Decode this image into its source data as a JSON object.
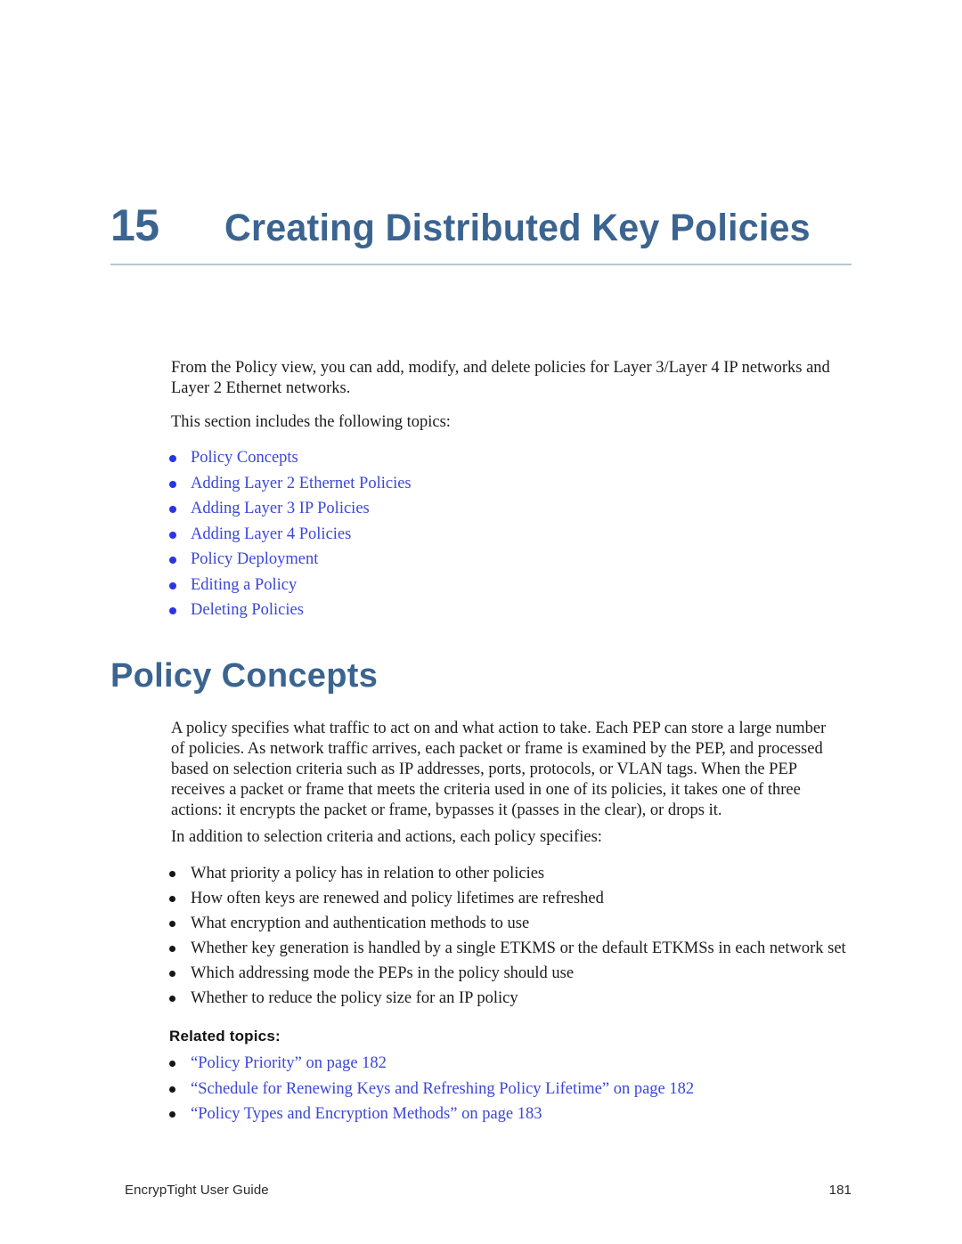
{
  "chapter": {
    "number": "15",
    "title": "Creating Distributed Key Policies"
  },
  "intro": {
    "paragraph": "From the Policy view, you can add, modify, and delete policies for Layer 3/Layer 4 IP networks and Layer 2 Ethernet networks.",
    "topics_lead": "This section includes the following topics:"
  },
  "topic_links": [
    {
      "label": "Policy Concepts"
    },
    {
      "label": "Adding Layer 2 Ethernet Policies"
    },
    {
      "label": "Adding Layer 3 IP Policies"
    },
    {
      "label": "Adding Layer 4 Policies"
    },
    {
      "label": "Policy Deployment"
    },
    {
      "label": "Editing a Policy"
    },
    {
      "label": "Deleting Policies"
    }
  ],
  "section": {
    "heading": "Policy Concepts",
    "paragraph": "A policy specifies what traffic to act on and what action to take. Each PEP can store a large number of policies. As network traffic arrives, each packet or frame is examined by the PEP, and processed based on selection criteria such as IP addresses, ports, protocols, or VLAN tags. When the PEP receives a packet or frame that meets the criteria used in one of its policies, it takes one of three actions: it encrypts the packet or frame, bypasses it (passes in the clear), or drops it.",
    "addition_lead": "In addition to selection criteria and actions, each policy specifies:"
  },
  "policy_specs": [
    {
      "text": "What priority a policy has in relation to other policies"
    },
    {
      "text": "How often keys are renewed and policy lifetimes are refreshed"
    },
    {
      "text": "What encryption and authentication methods to use"
    },
    {
      "text": "Whether key generation is handled by a single ETKMS or the default ETKMSs in each network set"
    },
    {
      "text": "Which addressing mode the PEPs in the policy should use"
    },
    {
      "text": "Whether to reduce the policy size for an IP policy"
    }
  ],
  "related": {
    "label": "Related topics:",
    "links": [
      {
        "label": "“Policy Priority” on page 182"
      },
      {
        "label": "“Schedule for Renewing Keys and Refreshing Policy Lifetime” on page 182"
      },
      {
        "label": "“Policy Types and Encryption Methods” on page 183"
      }
    ]
  },
  "footer": {
    "guide_title": "EncrypTight User Guide",
    "page_number": "181"
  },
  "colors": {
    "heading_blue": "#3b6490",
    "link_blue": "#3b46d8",
    "rule_gray": "#b4c6cc"
  }
}
